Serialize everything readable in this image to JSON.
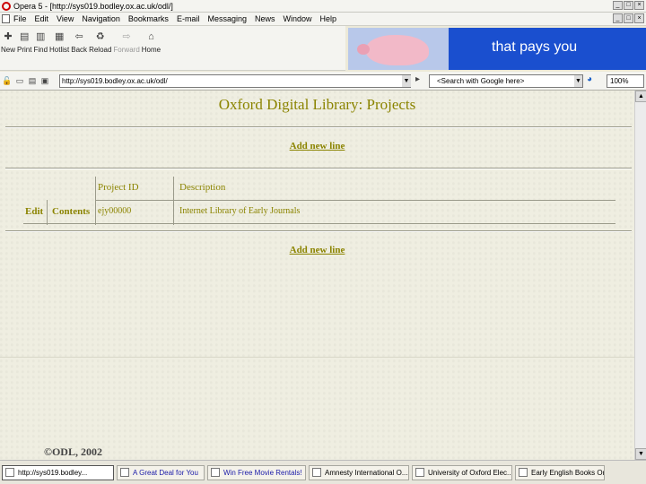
{
  "window": {
    "title": "Opera 5 - [http://sys019.bodley.ox.ac.uk/odl/]"
  },
  "menu": [
    "File",
    "Edit",
    "View",
    "Navigation",
    "Bookmarks",
    "E-mail",
    "Messaging",
    "News",
    "Window",
    "Help"
  ],
  "toolbar": [
    {
      "label": "New",
      "icon": "new-page-icon"
    },
    {
      "label": "Print",
      "icon": "print-icon"
    },
    {
      "label": "Find",
      "icon": "find-icon"
    },
    {
      "label": "Hotlist",
      "icon": "hotlist-icon"
    },
    {
      "label": "Back",
      "icon": "back-icon"
    },
    {
      "label": "Reload",
      "icon": "reload-icon"
    },
    {
      "label": "Forward",
      "icon": "forward-icon",
      "disabled": true
    },
    {
      "label": "Home",
      "icon": "home-icon"
    }
  ],
  "ad": {
    "text": "that pays you"
  },
  "address": {
    "url": "http://sys019.bodley.ox.ac.uk/odl/"
  },
  "search": {
    "text": "<Search with Google here>"
  },
  "zoom": "100%",
  "page": {
    "title": "Oxford Digital Library: Projects",
    "add_new_line": "Add new line",
    "table": {
      "headers": [
        "Project ID",
        "Description"
      ],
      "row": {
        "edit": "Edit",
        "contents": "Contents",
        "project_id": "ejy00000",
        "description": "Internet Library of Early Journals"
      }
    },
    "copyright": "©ODL, 2002"
  },
  "taskbar": [
    {
      "label": "http://sys019.bodley...",
      "active": true
    },
    {
      "label": "A Great Deal for You",
      "link": true
    },
    {
      "label": "Win Free Movie Rentals!",
      "link": true
    },
    {
      "label": "Amnesty International O..."
    },
    {
      "label": "University of Oxford Elec..."
    },
    {
      "label": "Early English Books Onlin..."
    }
  ]
}
